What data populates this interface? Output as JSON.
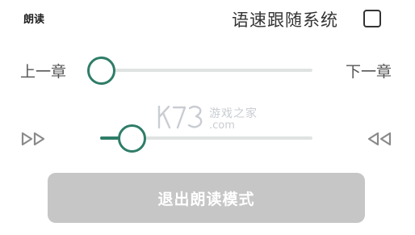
{
  "header": {
    "title": "朗读",
    "follow_system_label": "语速跟随系统",
    "follow_system_checked": false
  },
  "chapter": {
    "prev_label": "上一章",
    "next_label": "下一章",
    "progress": 0.0
  },
  "speed": {
    "slow_icon": "fast-forward-icon",
    "fast_icon": "rewind-icon",
    "level": 0.15
  },
  "watermark": {
    "logo_text": "K73",
    "chinese_text": "游戏之家",
    "domain_text": ".com"
  },
  "footer": {
    "exit_label": "退出朗读模式"
  },
  "colors": {
    "accent": "#2f7d68",
    "track": "#dfe3e1",
    "button_disabled": "#c6c6c6",
    "watermark": "#c9cdd2"
  }
}
